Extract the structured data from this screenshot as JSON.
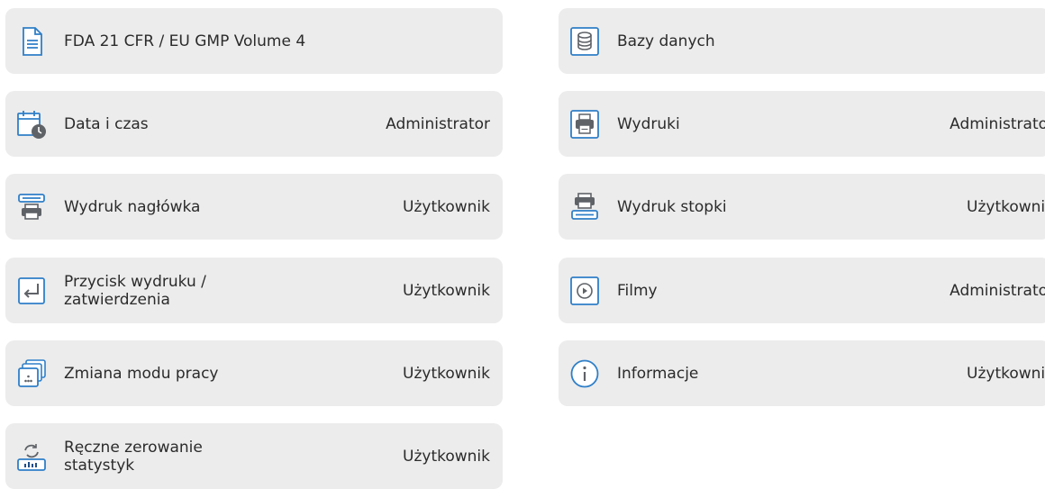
{
  "accent_color": "#2f7fc8",
  "tiles": [
    {
      "icon": "document-icon",
      "label": "FDA 21 CFR / EU GMP Volume 4",
      "level": ""
    },
    {
      "icon": "calendar-clock-icon",
      "label": "Data i czas",
      "level": "Administrator"
    },
    {
      "icon": "header-printout-icon",
      "label": "Wydruk nagłówka",
      "level": "Użytkownik"
    },
    {
      "icon": "enter-key-icon",
      "label": "Przycisk wydruku /\nzatwierdzenia",
      "level": "Użytkownik"
    },
    {
      "icon": "work-modes-icon",
      "label": "Zmiana modu pracy",
      "level": "Użytkownik"
    },
    {
      "icon": "reset-statistics-icon",
      "label": "Ręczne zerowanie\nstatystyk",
      "level": "Użytkownik"
    },
    {
      "icon": "database-icon",
      "label": "Bazy danych",
      "level": ""
    },
    {
      "icon": "printer-icon",
      "label": "Wydruki",
      "level": "Administrator"
    },
    {
      "icon": "footer-printout-icon",
      "label": "Wydruk stopki",
      "level": "Użytkownik"
    },
    {
      "icon": "play-icon",
      "label": "Filmy",
      "level": "Administrator"
    },
    {
      "icon": "info-icon",
      "label": "Informacje",
      "level": "Użytkownik"
    }
  ]
}
